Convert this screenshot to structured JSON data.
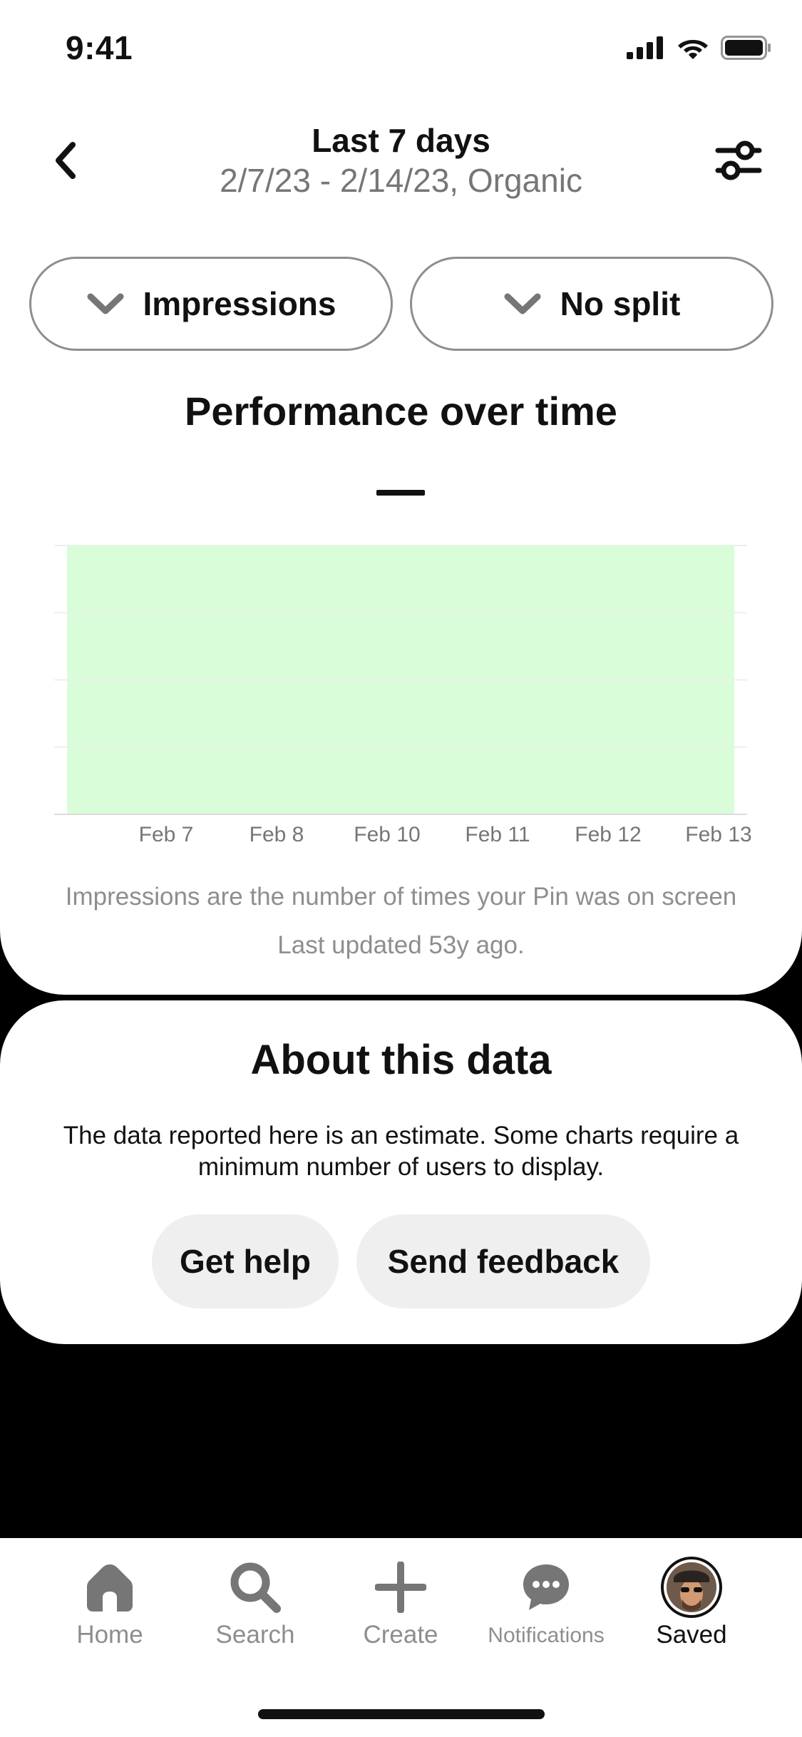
{
  "status_bar": {
    "time": "9:41"
  },
  "header": {
    "title": "Last 7 days",
    "subtitle": "2/7/23 - 2/14/23, Organic"
  },
  "selectors": {
    "metric": "Impressions",
    "split": "No split"
  },
  "section_title": "Performance over time",
  "metric_value": "—",
  "chart_data": {
    "type": "area",
    "categories": [
      "Feb 7",
      "Feb 8",
      "Feb 10",
      "Feb 11",
      "Feb 12",
      "Feb 13"
    ],
    "fill_color": "#d8fdd8",
    "grid": true,
    "gridline_count": 5
  },
  "footnote": "Impressions are the number of times your Pin was on screen",
  "last_updated": "Last updated 53y ago.",
  "about": {
    "title": "About this data",
    "text": "The data reported here is an estimate. Some charts require a minimum number of users to display.",
    "help_button": "Get help",
    "feedback_button": "Send feedback"
  },
  "tabbar": {
    "items": [
      {
        "label": "Home",
        "icon": "home-icon"
      },
      {
        "label": "Search",
        "icon": "search-icon"
      },
      {
        "label": "Create",
        "icon": "plus-icon"
      },
      {
        "label": "Notifications",
        "icon": "chat-bubble-icon"
      },
      {
        "label": "Saved",
        "icon": "avatar"
      }
    ],
    "active": "Saved"
  },
  "colors": {
    "accent_text": "#111111",
    "muted_text": "#767676",
    "chart_fill": "#d8fdd8",
    "button_bg": "#efefef"
  }
}
